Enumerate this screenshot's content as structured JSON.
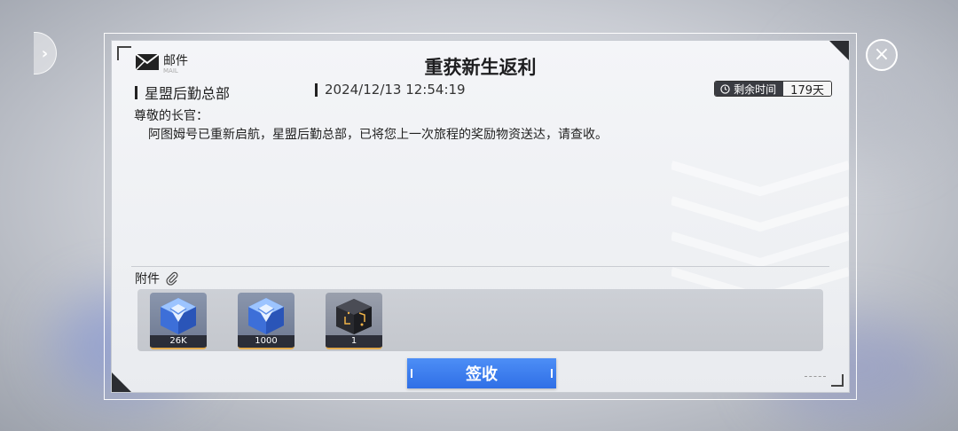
{
  "window": {
    "title": "重获新生返利"
  },
  "header": {
    "mail_label": "邮件",
    "mail_sub": "MAIL"
  },
  "mail": {
    "sender": "星盟后勤总部",
    "date": "2024/12/13 12:54:19",
    "remaining_label": "剩余时间",
    "remaining_value": "179天",
    "greeting": "尊敬的长官：",
    "body": "阿图姆号已重新启航，星盟后勤总部，已将您上一次旅程的奖励物资送达，请查收。"
  },
  "attachments": {
    "label": "附件",
    "items": [
      {
        "icon": "blue-crystal-cube-icon",
        "count": "26K"
      },
      {
        "icon": "blue-crystal-cube-icon",
        "count": "1000"
      },
      {
        "icon": "dark-supply-box-icon",
        "count": "1"
      }
    ]
  },
  "actions": {
    "sign_label": "签收"
  },
  "icons": {
    "left_nav": "chevron-right-icon",
    "close": "close-icon",
    "mail": "envelope-icon",
    "clock": "clock-icon",
    "clip": "paperclip-icon"
  },
  "colors": {
    "accent": "#2f6fe6",
    "dark": "#2b2d31",
    "item_border": "#e0a84c"
  }
}
